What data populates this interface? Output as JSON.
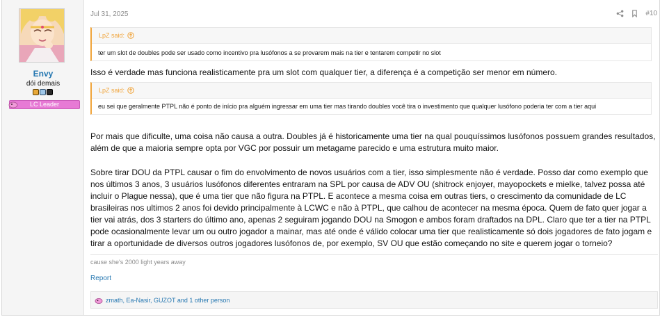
{
  "user": {
    "name": "Envy",
    "title": "dói demais",
    "banner": "LC Leader"
  },
  "post": {
    "date": "Jul 31, 2025",
    "number": "#10",
    "quotes": [
      {
        "author": "LpZ said:",
        "text": "ter um slot de doubles pode ser usado como incentivo pra lusófonos a se provarem mais na tier e tentarem competir no slot"
      },
      {
        "author": "LpZ said:",
        "text": "eu sei que geralmente PTPL não é ponto de início pra alguém ingressar em uma tier mas tirando doubles você tira o investimento que qualquer lusófono poderia ter com a tier aqui"
      }
    ],
    "paragraphs": [
      "Isso é verdade mas funciona realisticamente pra um slot com qualquer tier, a diferença é a competição ser menor em número.",
      "Por mais que dificulte, uma coisa não causa a outra. Doubles já é historicamente uma tier na qual pouquíssimos lusófonos possuem grandes resultados, além de que a maioria sempre opta por VGC por possuir um metagame parecido e uma estrutura muito maior.",
      "Sobre tirar DOU da PTPL causar o fim do envolvimento de novos usuários com a tier, isso simplesmente não é verdade. Posso dar como exemplo que nos últimos 3 anos, 3 usuários lusófonos diferentes entraram na SPL por causa de ADV OU (shitrock enjoyer, mayopockets e mielke, talvez possa até incluir o Plague nessa), que é uma tier que não figura na PTPL. E acontece a mesma coisa em outras tiers, o crescimento da comunidade de LC brasileiras nos ultimos 2 anos foi devido principalmente à LCWC e não à PTPL, que calhou de acontecer na mesma época. Quem de fato quer jogar a tier vai atrás, dos 3 starters do último ano, apenas 2 seguiram jogando DOU na Smogon e ambos foram draftados na DPL. Claro que ter a tier na PTPL pode ocasionalmente levar um ou outro jogador a mainar, mas até onde é válido colocar uma tier que realisticamente só dois jogadores de fato jogam e tirar a oportunidade de diversos outros jogadores lusófonos de, por exemplo, SV OU que estão começando no site e querem jogar o torneio?"
    ],
    "signature": "cause she's 2000 light years away",
    "report_label": "Report",
    "reactions_text": "zmath, Ea-Nasir, GUZOT and 1 other person"
  },
  "colors": {
    "link": "#2577b1",
    "quote_accent": "#f0a43a",
    "banner": "#e77ad5"
  },
  "icons": {
    "share": "share-icon",
    "bookmark": "bookmark-icon",
    "quote_jump": "arrow-up-circle-icon",
    "reaction": "reaction-icon"
  }
}
